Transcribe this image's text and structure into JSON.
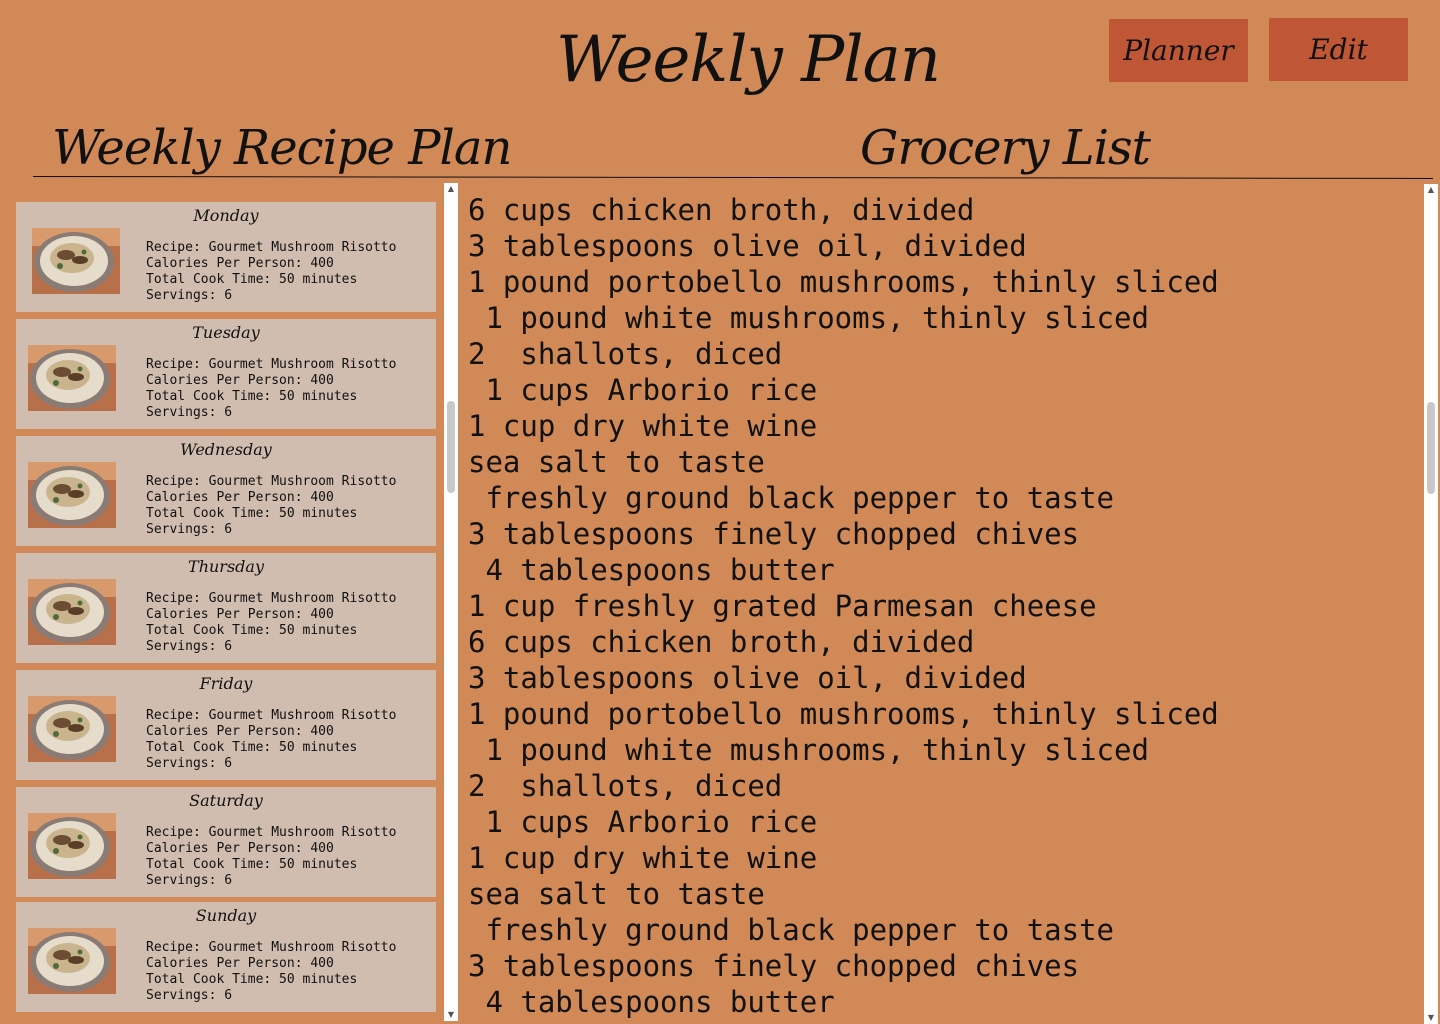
{
  "header": {
    "title": "Weekly Plan",
    "planner_label": "Planner",
    "edit_label": "Edit"
  },
  "sections": {
    "recipe_plan": "Weekly Recipe Plan",
    "grocery_list": "Grocery List"
  },
  "days": [
    {
      "day": "Monday",
      "recipe": "Recipe: Gourmet Mushroom Risotto",
      "calories": "Calories Per Person: 400",
      "cook_time": "Total Cook Time: 50 minutes",
      "servings": "Servings: 6"
    },
    {
      "day": "Tuesday",
      "recipe": "Recipe: Gourmet Mushroom Risotto",
      "calories": "Calories Per Person: 400",
      "cook_time": "Total Cook Time: 50 minutes",
      "servings": "Servings: 6"
    },
    {
      "day": "Wednesday",
      "recipe": "Recipe: Gourmet Mushroom Risotto",
      "calories": "Calories Per Person: 400",
      "cook_time": "Total Cook Time: 50 minutes",
      "servings": "Servings: 6"
    },
    {
      "day": "Thursday",
      "recipe": "Recipe: Gourmet Mushroom Risotto",
      "calories": "Calories Per Person: 400",
      "cook_time": "Total Cook Time: 50 minutes",
      "servings": "Servings: 6"
    },
    {
      "day": "Friday",
      "recipe": "Recipe: Gourmet Mushroom Risotto",
      "calories": "Calories Per Person: 400",
      "cook_time": "Total Cook Time: 50 minutes",
      "servings": "Servings: 6"
    },
    {
      "day": "Saturday",
      "recipe": "Recipe: Gourmet Mushroom Risotto",
      "calories": "Calories Per Person: 400",
      "cook_time": "Total Cook Time: 50 minutes",
      "servings": "Servings: 6"
    },
    {
      "day": "Sunday",
      "recipe": "Recipe: Gourmet Mushroom Risotto",
      "calories": "Calories Per Person: 400",
      "cook_time": "Total Cook Time: 50 minutes",
      "servings": "Servings: 6"
    }
  ],
  "grocery_items": [
    "6 cups chicken broth, divided",
    "3 tablespoons olive oil, divided",
    "1 pound portobello mushrooms, thinly sliced",
    " 1 pound white mushrooms, thinly sliced",
    "2  shallots, diced",
    " 1 cups Arborio rice",
    "1 cup dry white wine",
    "sea salt to taste",
    " freshly ground black pepper to taste",
    "3 tablespoons finely chopped chives",
    " 4 tablespoons butter",
    "1 cup freshly grated Parmesan cheese",
    "6 cups chicken broth, divided",
    "3 tablespoons olive oil, divided",
    "1 pound portobello mushrooms, thinly sliced",
    " 1 pound white mushrooms, thinly sliced",
    "2  shallots, diced",
    " 1 cups Arborio rice",
    "1 cup dry white wine",
    "sea salt to taste",
    " freshly ground black pepper to taste",
    "3 tablespoons finely chopped chives",
    " 4 tablespoons butter"
  ],
  "icons": {
    "recipe_photo": "risotto-photo",
    "scroll_up": "scroll-up-arrow",
    "scroll_down": "scroll-down-arrow"
  },
  "colors": {
    "background": "#d08957",
    "button": "#bf5636",
    "card": "#d0bdaf"
  }
}
